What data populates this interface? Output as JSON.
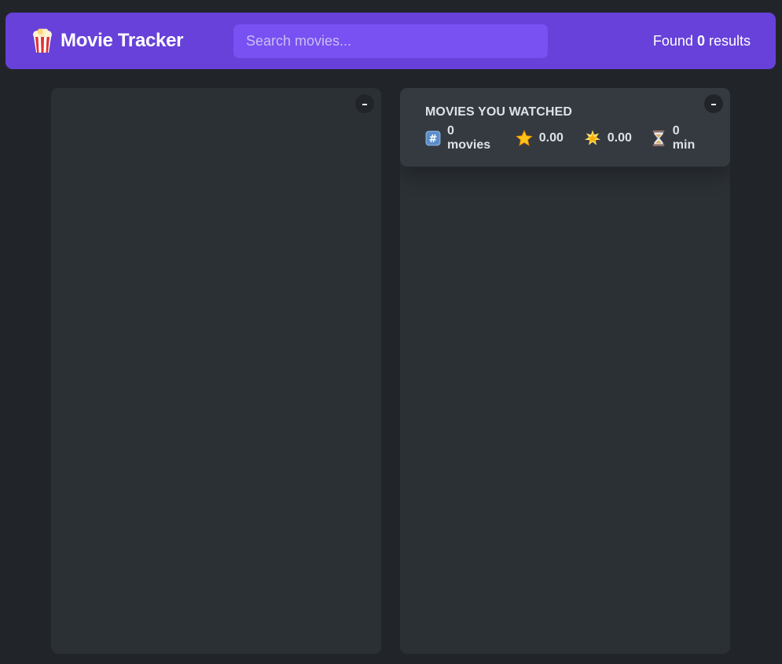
{
  "header": {
    "title": "Movie Tracker",
    "logo_icon": "popcorn-icon",
    "search_placeholder": "Search movies...",
    "search_value": "",
    "results_prefix": "Found ",
    "results_count": "0",
    "results_suffix": " results"
  },
  "left_box": {
    "toggle_label": "–"
  },
  "right_box": {
    "toggle_label": "–",
    "summary": {
      "title": "Movies you watched",
      "movies_count": "0",
      "movies_unit": "movies",
      "avg_imdb_rating": "0.00",
      "avg_user_rating": "0.00",
      "avg_runtime": "0",
      "runtime_unit": "min",
      "icons": [
        "hash-icon",
        "star-icon",
        "glowing-star-icon",
        "hourglass-icon"
      ]
    }
  },
  "colors": {
    "background": "#212529",
    "accent": "#6741d9",
    "accent_light": "#7950f2",
    "box": "#2b3035",
    "summary": "#343a40"
  }
}
